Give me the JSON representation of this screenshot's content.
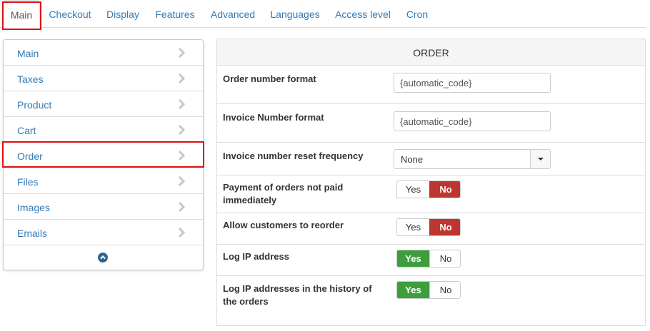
{
  "tabs": [
    "Main",
    "Checkout",
    "Display",
    "Features",
    "Advanced",
    "Languages",
    "Access level",
    "Cron"
  ],
  "sidebar": {
    "items": [
      "Main",
      "Taxes",
      "Product",
      "Cart",
      "Order",
      "Files",
      "Images",
      "Emails"
    ],
    "selected": "Order"
  },
  "panel": {
    "title": "ORDER",
    "order_number_format": {
      "label": "Order number format",
      "value": "{automatic_code}"
    },
    "invoice_number_format": {
      "label": "Invoice Number format",
      "value": "{automatic_code}"
    },
    "invoice_reset_frequency": {
      "label": "Invoice number reset frequency",
      "selected": "None"
    },
    "payment_not_paid": {
      "label": "Payment of orders not paid immediately",
      "selected": "No"
    },
    "allow_reorder": {
      "label": "Allow customers to reorder",
      "selected": "No"
    },
    "log_ip": {
      "label": "Log IP address",
      "selected": "Yes"
    },
    "log_ip_history": {
      "label": "Log IP addresses in the history of the orders",
      "selected": "Yes"
    },
    "yes_label": "Yes",
    "no_label": "No"
  },
  "colors": {
    "link": "#337ab7",
    "highlight": "#e01010",
    "no_active": "#bd362f",
    "yes_active": "#3e9e3e",
    "collapse_icon": "#2a6496"
  },
  "icons": {
    "sidebar_chevron": "chevron-right-icon",
    "collapse": "chevron-up-circle-icon",
    "select_caret": "caret-down-icon"
  }
}
